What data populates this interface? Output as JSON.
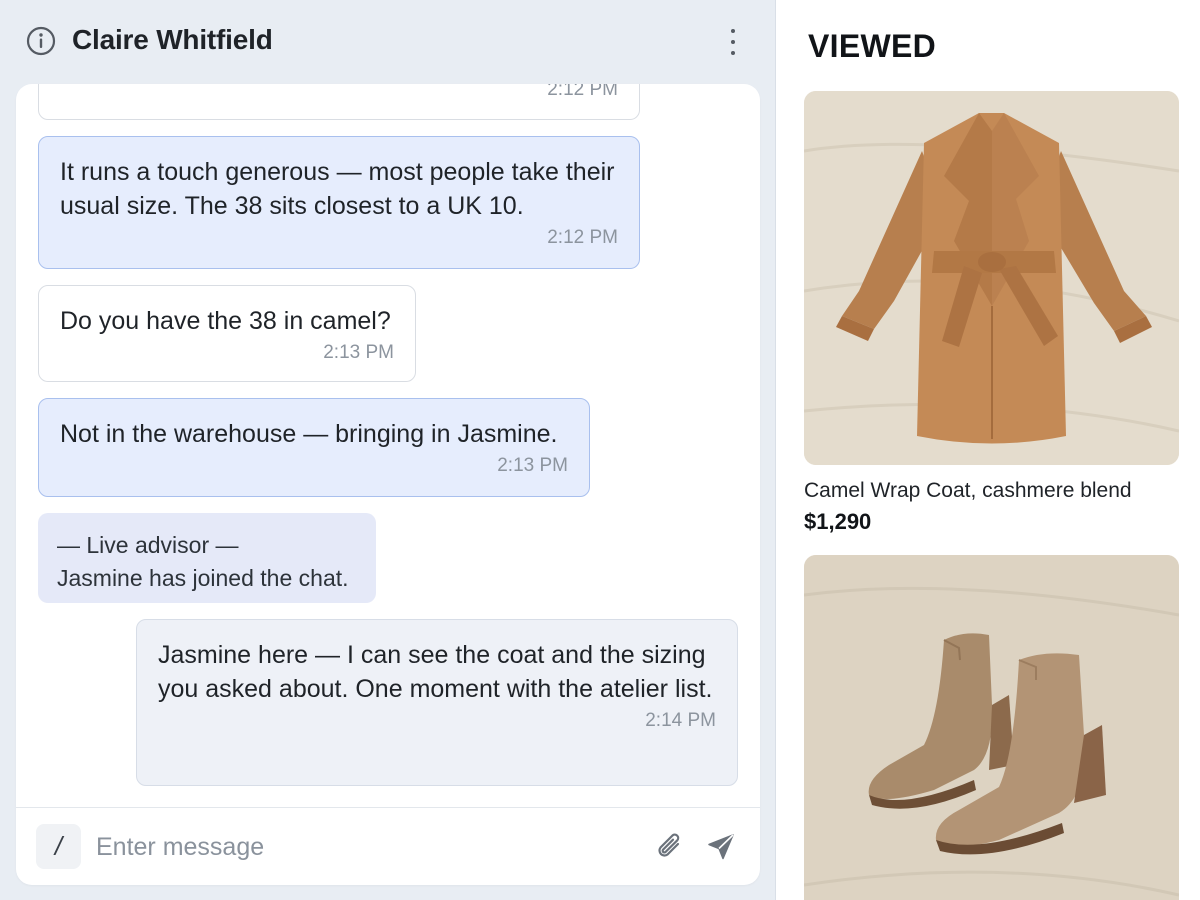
{
  "chat": {
    "contact_name": "Claire Whitfield",
    "messages": [
      {
        "time": "2:12 PM"
      },
      {
        "text": "It runs a touch generous — most people take their usual size. The 38 sits closest to a UK 10.",
        "time": "2:12 PM"
      },
      {
        "text": "Do you have the 38 in camel?",
        "time": "2:13 PM"
      },
      {
        "text": "Not in the warehouse — bringing in Jasmine.",
        "time": "2:13 PM"
      },
      {
        "line1": "— Live advisor —",
        "line2": "Jasmine has joined the chat."
      },
      {
        "text": "Jasmine here — I can see the coat and the sizing you asked about. One moment with the atelier list.",
        "time": "2:14 PM"
      }
    ],
    "composer": {
      "slash_label": "/",
      "placeholder": "Enter message",
      "value": ""
    }
  },
  "viewed": {
    "title": "VIEWED",
    "products": [
      {
        "name": "Camel Wrap Coat, cashmere blend",
        "price": "$1,290",
        "image_icon": "camel-coat-photo"
      },
      {
        "name": "",
        "price": "",
        "image_icon": "suede-ankle-boots-photo"
      }
    ]
  },
  "colors": {
    "panel_background": "#e8edf3",
    "agent_bubble": "#e6edfd",
    "agent_border": "#a9c0ee",
    "advisor_bubble": "#eef1f7",
    "system_bubble": "#e5e9f8",
    "timestamp": "#8c949e"
  }
}
